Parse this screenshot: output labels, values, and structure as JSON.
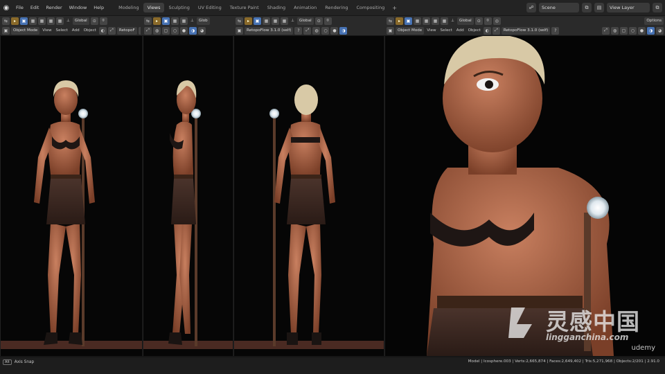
{
  "menu": {
    "items": [
      "File",
      "Edit",
      "Render",
      "Window",
      "Help"
    ]
  },
  "workspaces": [
    {
      "label": "Modeling",
      "active": false
    },
    {
      "label": "Views",
      "active": true
    },
    {
      "label": "Sculpting",
      "active": false
    },
    {
      "label": "UV Editing",
      "active": false
    },
    {
      "label": "Texture Paint",
      "active": false
    },
    {
      "label": "Shading",
      "active": false
    },
    {
      "label": "Animation",
      "active": false
    },
    {
      "label": "Rendering",
      "active": false
    },
    {
      "label": "Compositing",
      "active": false
    }
  ],
  "add_workspace": "+",
  "scene": {
    "name": "Scene"
  },
  "view_layer": {
    "name": "View Layer"
  },
  "options_label": "Options",
  "toolbar": {
    "orientation": "Global",
    "orientation_short": "Glob",
    "mode": "Object Mode",
    "view": "View",
    "select": "Select",
    "add": "Add",
    "object": "Object",
    "retopo_short": "RetopoF",
    "retopo_full": "RetopoFlow 3.1.0 (self)"
  },
  "statusbar": {
    "key": "Alt",
    "hint": "Axis Snap",
    "stats": "Model | Icosphere.003 | Verts:2,665,874 | Faces:2,649,402 | Tris:5,271,968 | Objects:2/201 | 2.91.0"
  },
  "watermark": {
    "cn_text": "灵感中国",
    "url": "lingganchina.com",
    "brand": "udemy"
  },
  "colors": {
    "accent_blue": "#4772b3",
    "skin": "#b5694a",
    "hair": "#d8c9a6",
    "leather": "#3a2620",
    "floor": "#4a2a22"
  }
}
